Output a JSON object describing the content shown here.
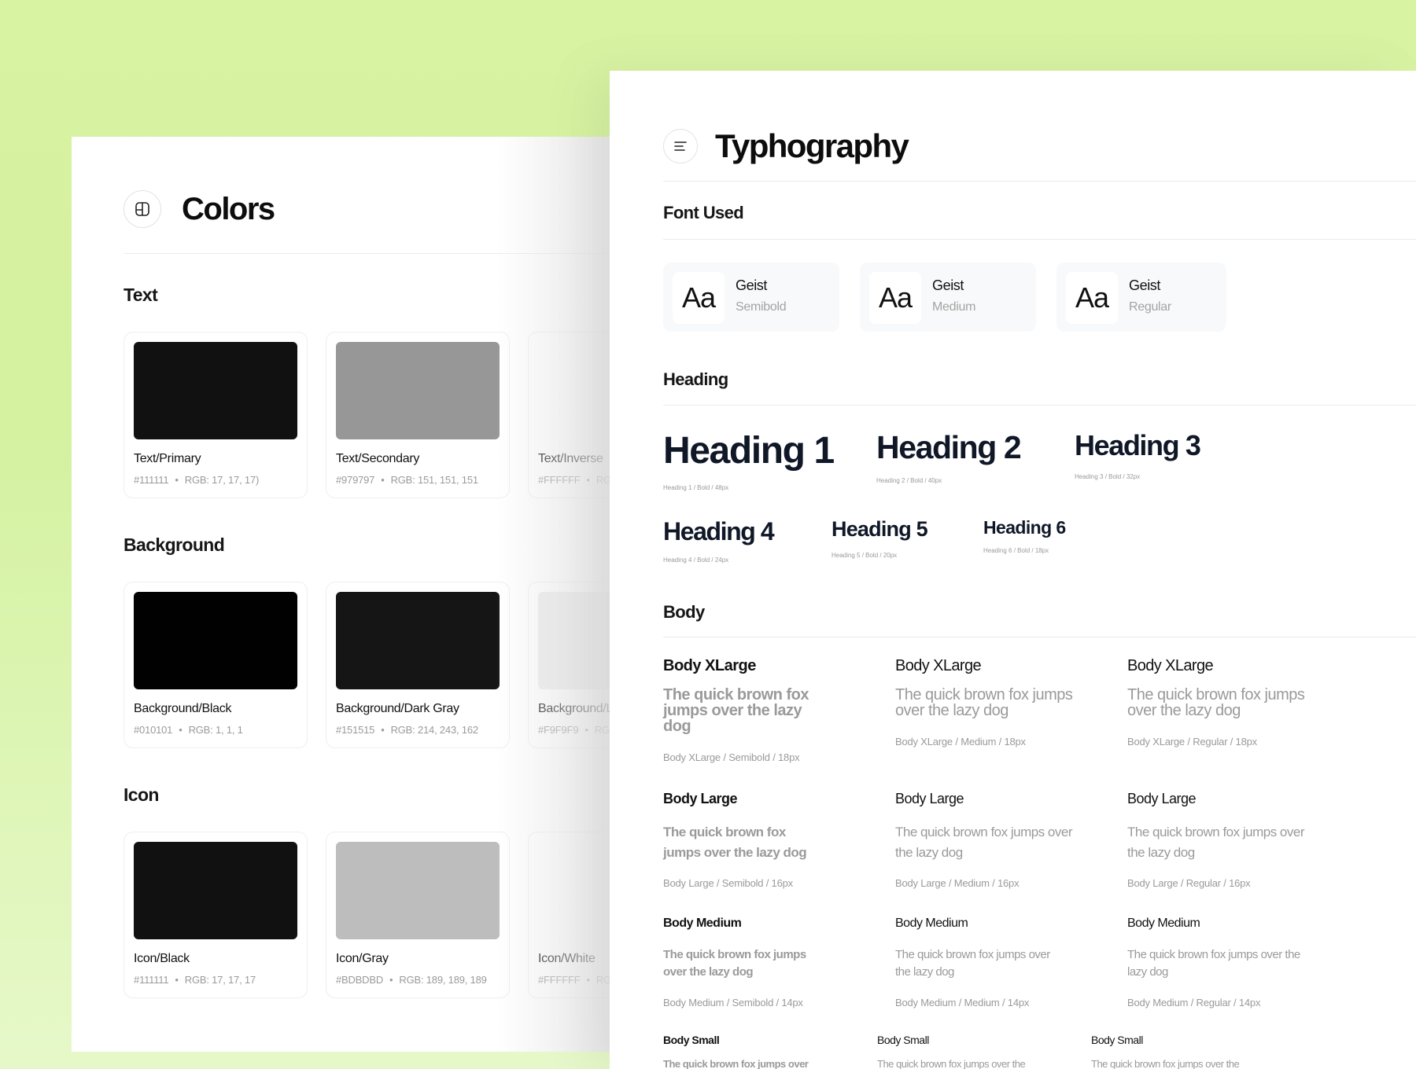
{
  "colors": {
    "title": "Colors",
    "icon": "layout-icon",
    "sections": [
      {
        "label": "Text",
        "cards": [
          {
            "name": "Text/Primary",
            "hex": "#111111",
            "rgb": "RGB: 17, 17, 17)",
            "color": "#111111"
          },
          {
            "name": "Text/Secondary",
            "hex": "#979797",
            "rgb": "RGB: 151, 151, 151",
            "color": "#979797"
          },
          {
            "name": "Text/Inverse",
            "hex": "#FFFFFF",
            "rgb": "RG",
            "color": "#FFFFFF"
          }
        ]
      },
      {
        "label": "Background",
        "cards": [
          {
            "name": "Background/Black",
            "hex": "#010101",
            "rgb": "RGB: 1, 1, 1",
            "color": "#010101"
          },
          {
            "name": "Background/Dark Gray",
            "hex": "#151515",
            "rgb": "RGB: 214, 243, 162",
            "color": "#151515"
          },
          {
            "name": "Background/L",
            "hex": "#F9F9F9",
            "rgb": "RG",
            "color": "#ECECEC"
          }
        ]
      },
      {
        "label": "Icon",
        "cards": [
          {
            "name": "Icon/Black",
            "hex": "#111111",
            "rgb": "RGB: 17, 17, 17",
            "color": "#111111"
          },
          {
            "name": "Icon/Gray",
            "hex": "#BDBDBD",
            "rgb": "RGB: 189, 189, 189",
            "color": "#BDBDBD"
          },
          {
            "name": "Icon/White",
            "hex": "#FFFFFF",
            "rgb": "RG",
            "color": "#FFFFFF"
          }
        ]
      }
    ]
  },
  "typography": {
    "title": "Typhography",
    "icon": "align-left-icon",
    "font_used_label": "Font Used",
    "fonts": [
      {
        "sample": "Aa",
        "name": "Geist",
        "weight": "Semibold"
      },
      {
        "sample": "Aa",
        "name": "Geist",
        "weight": "Medium"
      },
      {
        "sample": "Aa",
        "name": "Geist",
        "weight": "Regular"
      }
    ],
    "heading_label": "Heading",
    "headings": [
      {
        "text": "Heading 1",
        "meta": "Heading 1 / Bold / 48px"
      },
      {
        "text": "Heading 2",
        "meta": "Heading 2 / Bold / 40px"
      },
      {
        "text": "Heading 3",
        "meta": "Heading 3 / Bold / 32px"
      },
      {
        "text": "Heading 4",
        "meta": "Heading 4 / Bold / 24px"
      },
      {
        "text": "Heading 5",
        "meta": "Heading 5 / Bold / 20px"
      },
      {
        "text": "Heading 6",
        "meta": "Heading 6 / Bold / 18px"
      }
    ],
    "body_label": "Body",
    "body_rows": [
      {
        "title": "Body XLarge",
        "items": [
          {
            "sample": "The quick brown fox jumps over the lazy dog",
            "meta": "Body XLarge / Semibold / 18px"
          },
          {
            "sample": "The quick brown fox jumps over the lazy dog",
            "meta": "Body XLarge / Medium / 18px"
          },
          {
            "sample": "The quick brown fox jumps over the lazy dog",
            "meta": "Body XLarge / Regular / 18px"
          }
        ]
      },
      {
        "title": "Body Large",
        "items": [
          {
            "sample": "The quick brown fox jumps over the lazy dog",
            "meta": "Body Large / Semibold / 16px"
          },
          {
            "sample": "The quick brown fox jumps over the lazy dog",
            "meta": "Body Large / Medium / 16px"
          },
          {
            "sample": "The quick brown fox jumps over the lazy dog",
            "meta": "Body Large / Regular / 16px"
          }
        ]
      },
      {
        "title": "Body Medium",
        "items": [
          {
            "sample": "The quick brown fox jumps over the lazy dog",
            "meta": "Body Medium / Semibold / 14px"
          },
          {
            "sample": "The quick brown fox jumps over the lazy dog",
            "meta": "Body Medium / Medium / 14px"
          },
          {
            "sample": "The quick brown fox jumps over the lazy dog",
            "meta": "Body Medium / Regular / 14px"
          }
        ]
      },
      {
        "title": "Body Small",
        "items": [
          {
            "sample": "The quick brown fox jumps over",
            "meta": ""
          },
          {
            "sample": "The quick brown fox jumps over the",
            "meta": ""
          },
          {
            "sample": "The quick brown fox jumps over the",
            "meta": ""
          }
        ]
      }
    ]
  }
}
